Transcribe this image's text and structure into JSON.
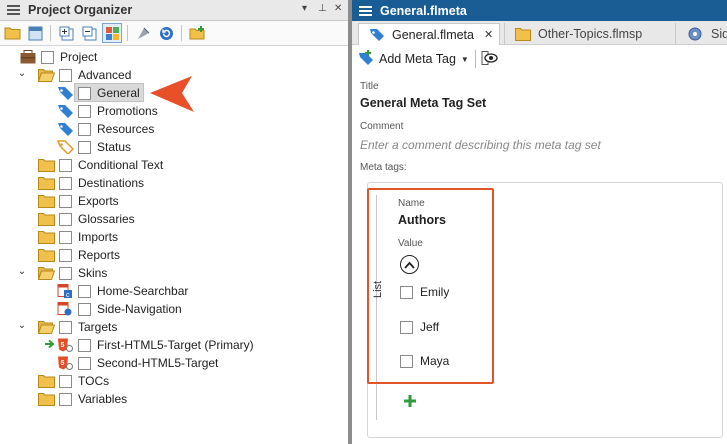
{
  "left_pane": {
    "title": "Project Organizer",
    "controls": {
      "dropdown": "▾",
      "pin": "⊥",
      "close": "✕"
    }
  },
  "tree": {
    "items": [
      {
        "label": "Project"
      },
      {
        "label": "Advanced"
      },
      {
        "label": "General"
      },
      {
        "label": "Promotions"
      },
      {
        "label": "Resources"
      },
      {
        "label": "Status"
      },
      {
        "label": "Conditional Text"
      },
      {
        "label": "Destinations"
      },
      {
        "label": "Exports"
      },
      {
        "label": "Glossaries"
      },
      {
        "label": "Imports"
      },
      {
        "label": "Reports"
      },
      {
        "label": "Skins"
      },
      {
        "label": "Home-Searchbar"
      },
      {
        "label": "Side-Navigation"
      },
      {
        "label": "Targets"
      },
      {
        "label": "First-HTML5-Target (Primary)"
      },
      {
        "label": "Second-HTML5-Target"
      },
      {
        "label": "TOCs"
      },
      {
        "label": "Variables"
      }
    ]
  },
  "editor": {
    "window_title": "General.flmeta",
    "tabs": [
      {
        "label": "General.flmeta",
        "close": "✕"
      },
      {
        "label": "Other-Topics.flmsp"
      },
      {
        "label": "Sid"
      }
    ],
    "toolbar": {
      "add_meta_tag_label": "Add Meta Tag"
    },
    "title_label": "Title",
    "title_value": "General Meta Tag Set",
    "comment_label": "Comment",
    "comment_placeholder": "Enter a comment describing this meta tag set",
    "meta_tags_label": "Meta tags:",
    "meta_tag": {
      "list_label": "List",
      "name_label": "Name",
      "name_value": "Authors",
      "value_label": "Value",
      "values": [
        {
          "label": "Emily"
        },
        {
          "label": "Jeff"
        },
        {
          "label": "Maya"
        }
      ]
    }
  },
  "colors": {
    "accent": "#1a5d94",
    "annotation": "#e8502a",
    "highlight_border": "#e0542a"
  }
}
